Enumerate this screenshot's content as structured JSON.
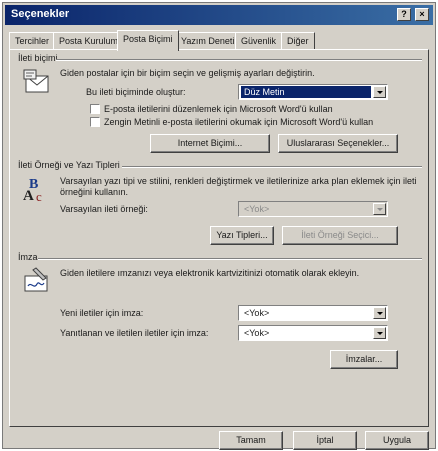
{
  "title": "Seçenekler",
  "titlebar_buttons": [
    "?",
    "×"
  ],
  "tabs": [
    "Tercihler",
    "Posta Kurulumu",
    "Posta Biçimi",
    "Yazım Denetimi",
    "Güvenlik",
    "Diğer"
  ],
  "active_tab": 2,
  "message_format": {
    "label": "İleti biçimi",
    "description": "Giden postalar için bir biçim seçin ve gelişmiş ayarları değiştirin.",
    "compose_label": "Bu ileti biçiminde oluştur:",
    "compose_value": "Düz Metin",
    "checkbox1": "E-posta iletilerini düzenlemek için Microsoft Word'ü kullan",
    "checkbox2": "Zengin Metinli e-posta iletilerini okumak için Microsoft Word'ü kullan",
    "internet_format_button": "Internet Biçimi...",
    "intl_options_button": "Uluslararası Seçenekler..."
  },
  "stationery": {
    "label": "İleti Örneği ve Yazı Tipleri",
    "description": "Varsayılan yazı tipi ve stilini, renkleri değiştirmek ve iletilerinize arka plan eklemek için ileti örneğini kullanın.",
    "default_label": "Varsayılan ileti örneği:",
    "default_value": "<Yok>",
    "fonts_button": "Yazı Tipleri...",
    "stationery_picker_button": "İleti Örneği Seçici..."
  },
  "signature": {
    "label": "İmza",
    "description": "Giden iletilere ımzanızı veya elektronik kartvizitinizi otomatik olarak ekleyin.",
    "new_label": "Yeni iletiler için imza:",
    "new_value": "<Yok>",
    "reply_label": "Yanıtlanan ve iletilen iletiler için imza:",
    "reply_value": "<Yok>",
    "signatures_button": "İmzalar..."
  },
  "footer": {
    "ok": "Tamam",
    "cancel": "İptal",
    "apply": "Uygula"
  }
}
